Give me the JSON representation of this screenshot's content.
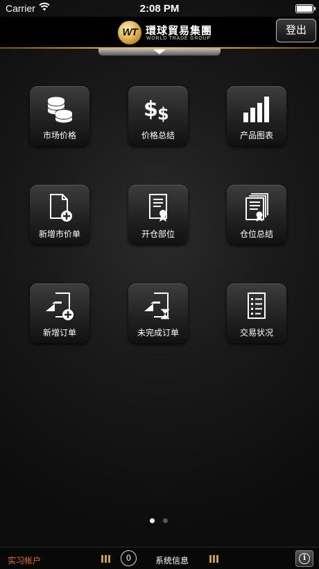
{
  "status_bar": {
    "carrier": "Carrier",
    "time": "2:08 PM"
  },
  "header": {
    "logo_mark": "WT",
    "logo_cn": "環球貿易集團",
    "logo_en": "WORLD TRADE GROUP",
    "logout": "登出"
  },
  "grid": [
    {
      "label": "市场价格",
      "icon": "coins-stack-icon"
    },
    {
      "label": "价格总结",
      "icon": "dollar-signs-icon"
    },
    {
      "label": "产品图表",
      "icon": "bar-chart-icon"
    },
    {
      "label": "新增市价单",
      "icon": "new-document-icon"
    },
    {
      "label": "开仓部位",
      "icon": "certificate-document-icon"
    },
    {
      "label": "仓位总结",
      "icon": "stacked-certificates-icon"
    },
    {
      "label": "新增订单",
      "icon": "hand-add-document-icon"
    },
    {
      "label": "未完成订单",
      "icon": "hand-hourglass-document-icon"
    },
    {
      "label": "交易状况",
      "icon": "checklist-icon"
    }
  ],
  "pager": {
    "pages": 2,
    "current": 1
  },
  "bottom_bar": {
    "account": "实习帐户",
    "message_count": "0",
    "system_info": "系统信息",
    "info": "i"
  },
  "colors": {
    "gold": "#d2a449",
    "account_orange": "#e36f1f",
    "tile_top": "#3d3d3d",
    "tile_bottom": "#111111"
  }
}
